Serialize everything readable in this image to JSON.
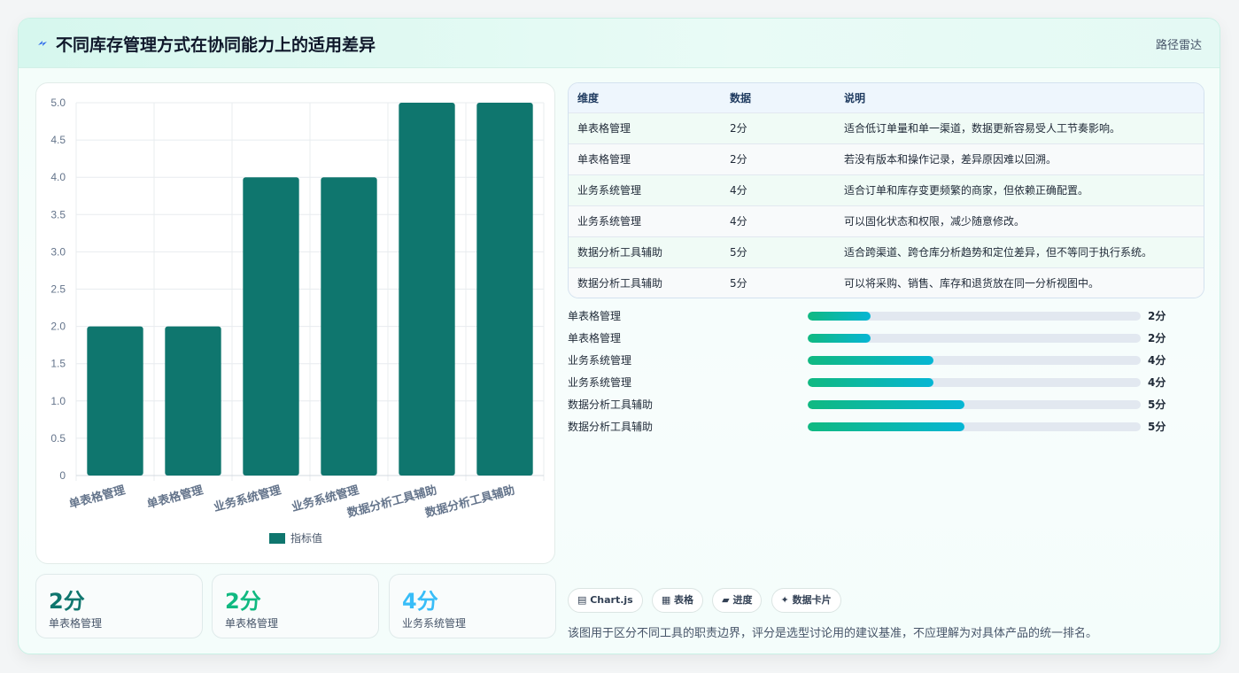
{
  "header": {
    "title": "不同库存管理方式在协同能力上的适用差异",
    "tag": "路径雷达"
  },
  "colors": {
    "bar": "#0f766e",
    "accent": "#10b981",
    "kpi": [
      "#0f766e",
      "#10b981",
      "#38bdf8"
    ]
  },
  "chart_data": {
    "type": "bar",
    "categories": [
      "单表格管理",
      "单表格管理",
      "业务系统管理",
      "业务系统管理",
      "数据分析工具辅助",
      "数据分析工具辅助"
    ],
    "series": [
      {
        "name": "指标值",
        "values": [
          2,
          2,
          4,
          4,
          5,
          5
        ]
      }
    ],
    "ylim": [
      0,
      5
    ],
    "yticks": [
      "0",
      "0.5",
      "1.0",
      "1.5",
      "2.0",
      "2.5",
      "3.0",
      "3.5",
      "4.0",
      "4.5",
      "5.0"
    ],
    "grid": true,
    "legend": "bottom"
  },
  "kpis": [
    {
      "value": "2分",
      "label": "单表格管理"
    },
    {
      "value": "2分",
      "label": "单表格管理"
    },
    {
      "value": "4分",
      "label": "业务系统管理"
    }
  ],
  "table": {
    "headers": [
      "维度",
      "数据",
      "说明"
    ],
    "rows": [
      [
        "单表格管理",
        "2分",
        "适合低订单量和单一渠道，数据更新容易受人工节奏影响。"
      ],
      [
        "单表格管理",
        "2分",
        "若没有版本和操作记录，差异原因难以回溯。"
      ],
      [
        "业务系统管理",
        "4分",
        "适合订单和库存变更频繁的商家，但依赖正确配置。"
      ],
      [
        "业务系统管理",
        "4分",
        "可以固化状态和权限，减少随意修改。"
      ],
      [
        "数据分析工具辅助",
        "5分",
        "适合跨渠道、跨仓库分析趋势和定位差异，但不等同于执行系统。"
      ],
      [
        "数据分析工具辅助",
        "5分",
        "可以将采购、销售、库存和退货放在同一分析视图中。"
      ]
    ]
  },
  "progress": [
    {
      "label": "单表格管理",
      "value": "2分",
      "score": 2
    },
    {
      "label": "单表格管理",
      "value": "2分",
      "score": 2
    },
    {
      "label": "业务系统管理",
      "value": "4分",
      "score": 4
    },
    {
      "label": "业务系统管理",
      "value": "4分",
      "score": 4
    },
    {
      "label": "数据分析工具辅助",
      "value": "5分",
      "score": 5
    },
    {
      "label": "数据分析工具辅助",
      "value": "5分",
      "score": 5
    }
  ],
  "progress_max": 10.6,
  "chips": [
    "▤ Chart.js",
    "▦ 表格",
    "▰ 进度",
    "✦ 数据卡片"
  ],
  "footnote": "该图用于区分不同工具的职责边界，评分是选型讨论用的建议基准，不应理解为对具体产品的统一排名。"
}
